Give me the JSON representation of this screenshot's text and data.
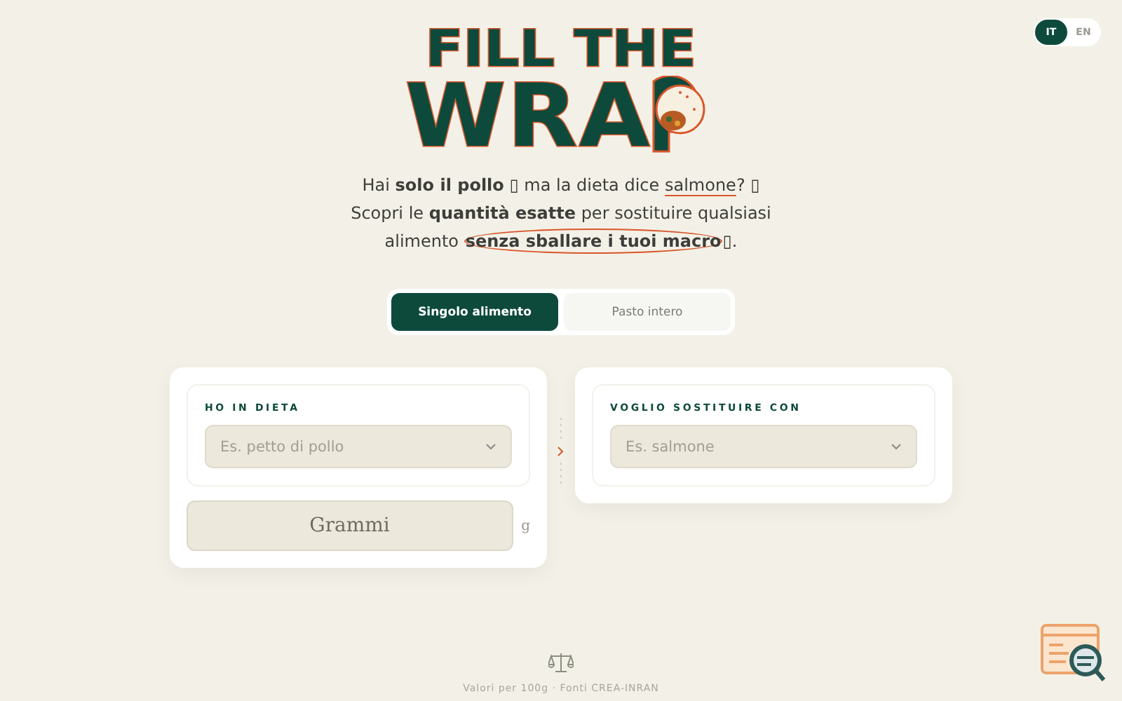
{
  "language_switch": [
    {
      "label": "IT",
      "selected": true
    },
    {
      "label": "EN",
      "selected": false
    }
  ],
  "logo": {
    "line_1": "FILL THE",
    "line_2": "WRA"
  },
  "intro": [
    [
      {
        "kind": "plain",
        "text": "Hai "
      },
      {
        "kind": "bold",
        "text": "solo il pollo"
      },
      {
        "kind": "plain",
        "text": " ▯ ma la dieta dice "
      },
      {
        "kind": "underline",
        "text": "salmone"
      },
      {
        "kind": "plain",
        "text": "? ▯"
      }
    ],
    [
      {
        "kind": "plain",
        "text": "Scopri le "
      },
      {
        "kind": "bold",
        "text": "quantità esatte"
      },
      {
        "kind": "plain",
        "text": " per sostituire qualsiasi"
      }
    ],
    [
      {
        "kind": "plain",
        "text": "alimento "
      },
      {
        "kind": "circled",
        "text": "senza sballare i tuoi macro"
      },
      {
        "kind": "plain",
        "text": "▯."
      }
    ]
  ],
  "mode_tabs": [
    {
      "label": "Singolo alimento",
      "selected": true
    },
    {
      "label": "Pasto intero",
      "selected": false
    }
  ],
  "have_card": {
    "label": "HO IN DIETA",
    "placeholder": "Es. petto di pollo",
    "grams_placeholder": "Grammi",
    "unit": "g"
  },
  "swap_card": {
    "label": "VOGLIO SOSTITUIRE CON",
    "placeholder": "Es. salmone"
  },
  "footer": {
    "note": "Valori per 100g · Fonti CREA-INRAN"
  }
}
